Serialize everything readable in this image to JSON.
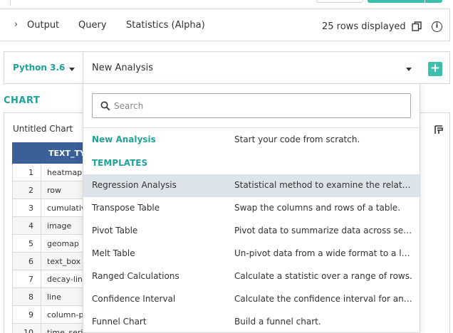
{
  "colors": {
    "accent_teal": "#1fa397",
    "button_teal": "#3dbfae",
    "table_header": "#3b5f99",
    "highlight_row": "#dde3ea"
  },
  "result_bar": {
    "tabs": [
      {
        "label": "Output"
      },
      {
        "label": "Query"
      },
      {
        "label": "Statistics (Alpha)"
      }
    ],
    "rows_displayed": "25 rows displayed"
  },
  "editor_bar": {
    "language": "Python 3.6",
    "analysis": "New Analysis"
  },
  "chart": {
    "heading": "CHART",
    "title": "Untitled Chart",
    "table": {
      "column_header": "TEXT_TY",
      "rows": [
        {
          "index": "1",
          "type": "heatmap"
        },
        {
          "index": "2",
          "type": "row"
        },
        {
          "index": "3",
          "type": "cumulative"
        },
        {
          "index": "4",
          "type": "image"
        },
        {
          "index": "5",
          "type": "geomap"
        },
        {
          "index": "6",
          "type": "text_box"
        },
        {
          "index": "7",
          "type": "decay-line"
        },
        {
          "index": "8",
          "type": "line"
        },
        {
          "index": "9",
          "type": "column-p"
        },
        {
          "index": "10",
          "type": "time_seri"
        }
      ]
    }
  },
  "dropdown": {
    "search_placeholder": "Search",
    "new_analysis": {
      "name": "New Analysis",
      "description": "Start your code from scratch."
    },
    "templates_label": "TEMPLATES",
    "templates": [
      {
        "name": "Regression Analysis",
        "description": "Statistical method to examine the relationship between variables."
      },
      {
        "name": "Transpose Table",
        "description": "Swap the columns and rows of a table."
      },
      {
        "name": "Pivot Table",
        "description": "Pivot data to summarize data across selected columns."
      },
      {
        "name": "Melt Table",
        "description": "Un-pivot data from a wide format to a long format."
      },
      {
        "name": "Ranged Calculations",
        "description": "Calculate a statistic over a range of rows."
      },
      {
        "name": "Confidence Interval",
        "description": "Calculate the confidence interval for an estimate."
      },
      {
        "name": "Funnel Chart",
        "description": "Build a funnel chart."
      }
    ]
  },
  "icons": {
    "expand": "chevron-right-icon",
    "copy": "copy-icon",
    "info": "info-icon",
    "language_caret": "caret-down-icon",
    "add": "plus-icon",
    "search": "search-icon",
    "chart_edit": "chart-edit-icon"
  }
}
